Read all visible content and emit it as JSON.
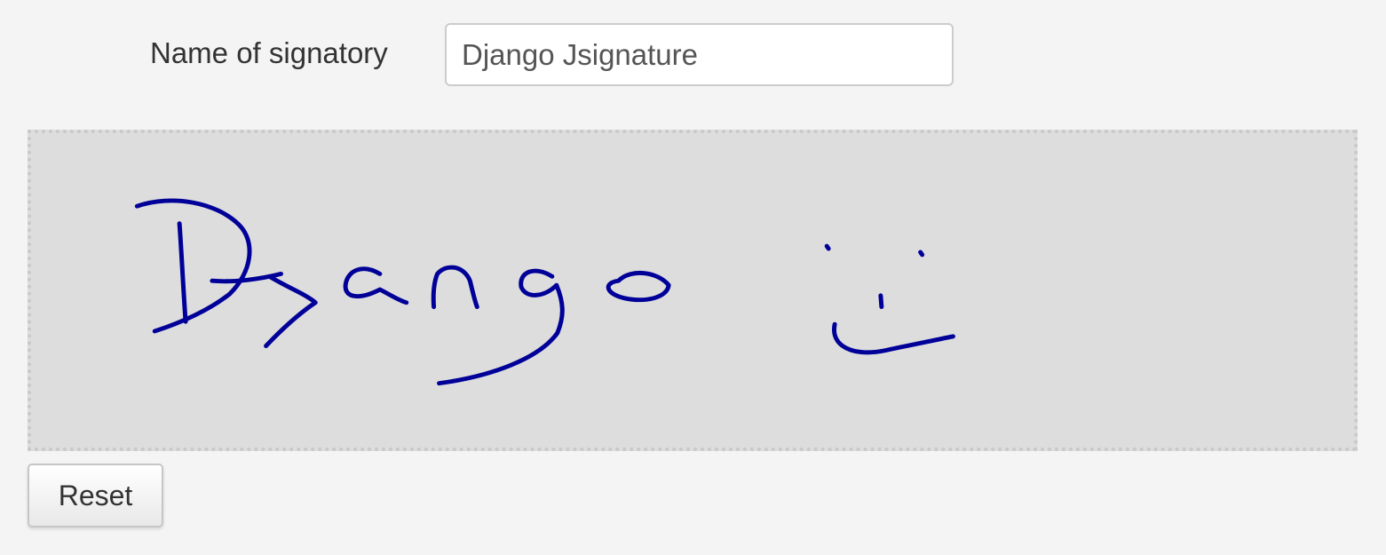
{
  "form": {
    "name_label": "Name of signatory",
    "name_value": "Django Jsignature"
  },
  "signature": {
    "ink_color": "#000099",
    "pad_background": "#dddddd"
  },
  "actions": {
    "reset_label": "Reset"
  }
}
